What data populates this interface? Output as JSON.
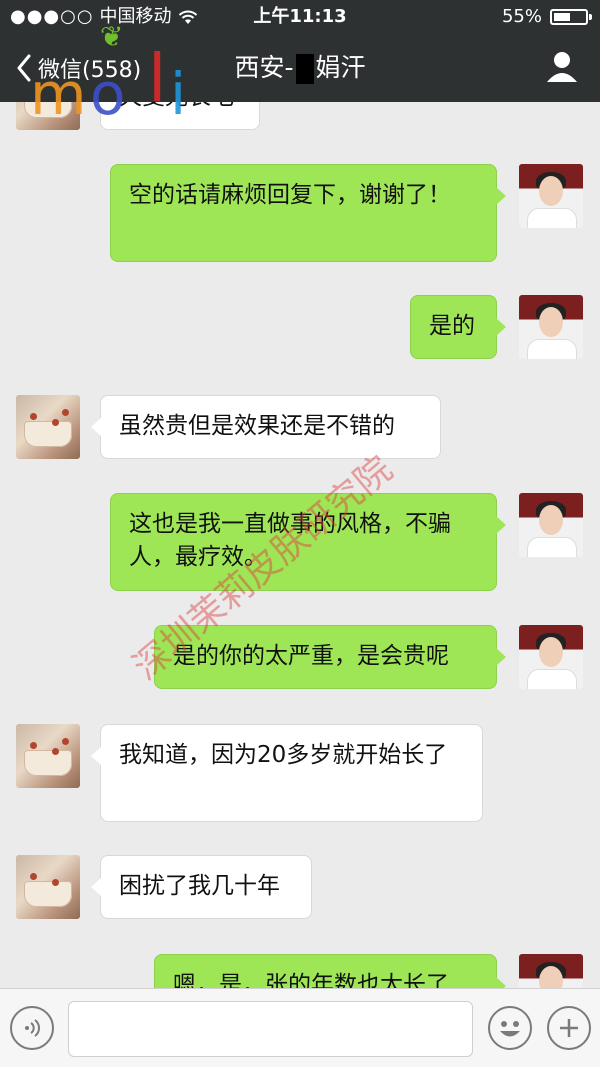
{
  "status_bar": {
    "signal": "●●●○○",
    "carrier": "中国移动",
    "time": "上午11:13",
    "battery_text": "55%",
    "battery_level": 0.55
  },
  "nav": {
    "back_label": "微信(558)",
    "title_parts": [
      "西安-",
      "娟汗"
    ]
  },
  "messages": [
    {
      "from": "other",
      "text": "天变光长毛"
    },
    {
      "from": "me",
      "text": "空的话请麻烦回复下，谢谢了！"
    },
    {
      "from": "me",
      "text": "是的"
    },
    {
      "from": "other",
      "text": "虽然贵但是效果还是不错的"
    },
    {
      "from": "me",
      "text": "这也是我一直做事的风格，不骗人，最疗效。"
    },
    {
      "from": "me",
      "text": "是的你的太严重，是会贵呢"
    },
    {
      "from": "other",
      "text": "我知道，因为20多岁就开始长了"
    },
    {
      "from": "other",
      "text": "困扰了我几十年"
    },
    {
      "from": "me",
      "text": "嗯，是，张的年数也太长了"
    }
  ],
  "watermarks": {
    "logo_letters": [
      "m",
      "o",
      "l",
      "i"
    ],
    "stamp_text": "深圳茉莉皮肤研究院"
  },
  "bottom_bar": {
    "input_value": ""
  },
  "colors": {
    "nav_bg": "#2e3132",
    "chat_bg": "#ebebeb",
    "bubble_me": "#9fe657",
    "bubble_other": "#ffffff"
  }
}
